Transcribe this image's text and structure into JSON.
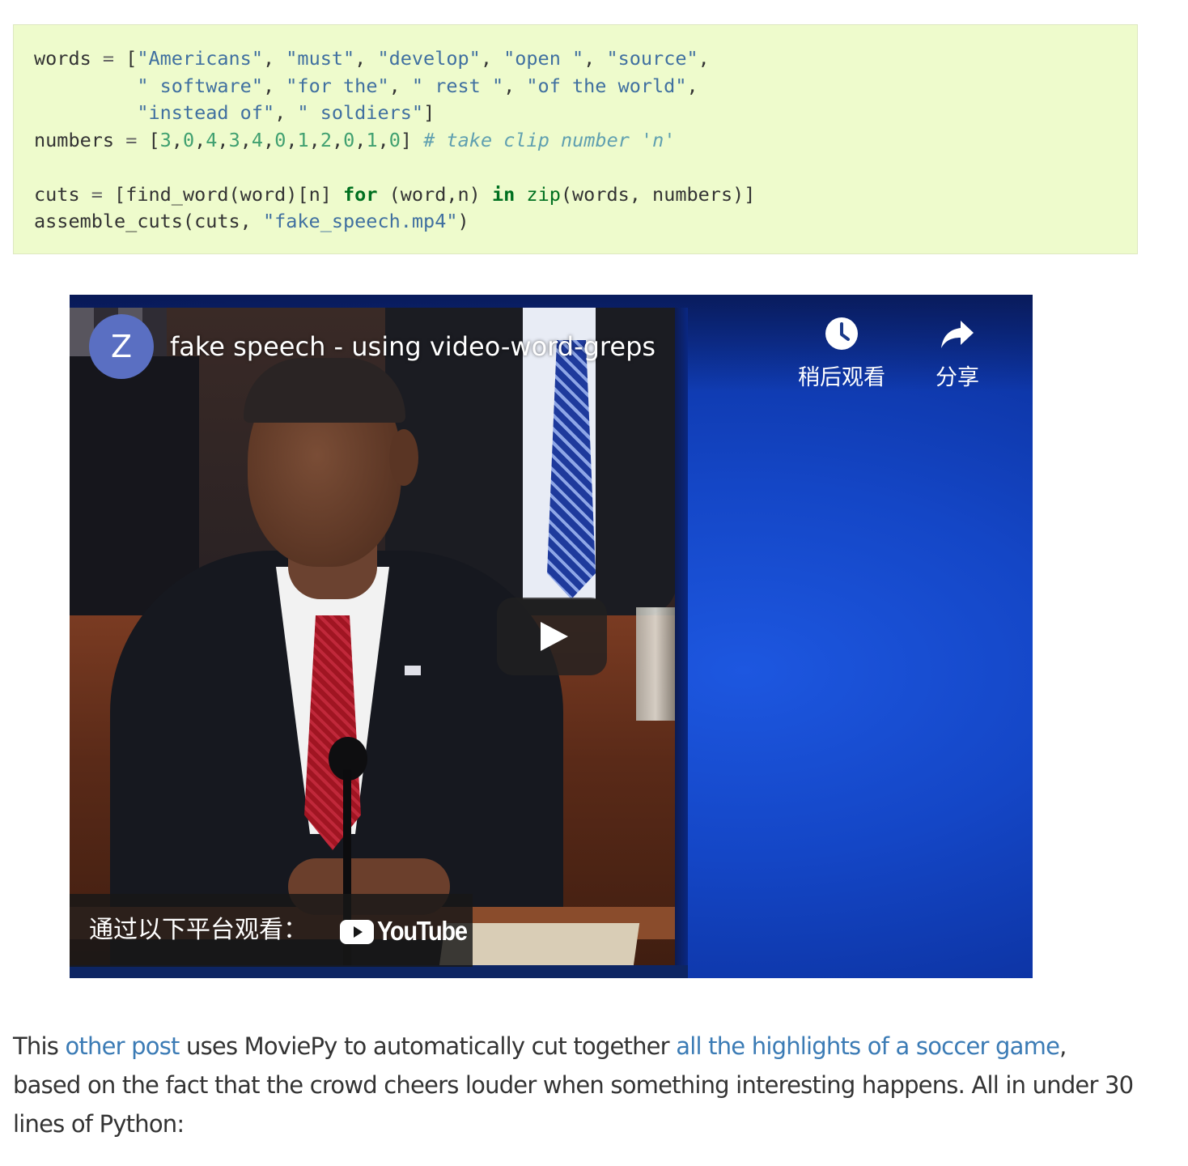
{
  "code_block": {
    "lines": [
      [
        {
          "t": "words ",
          "c": ""
        },
        {
          "t": "=",
          "c": "op"
        },
        {
          "t": " [",
          "c": ""
        },
        {
          "t": "\"Americans\"",
          "c": "str"
        },
        {
          "t": ", ",
          "c": ""
        },
        {
          "t": "\"must\"",
          "c": "str"
        },
        {
          "t": ", ",
          "c": ""
        },
        {
          "t": "\"develop\"",
          "c": "str"
        },
        {
          "t": ", ",
          "c": ""
        },
        {
          "t": "\"open \"",
          "c": "str"
        },
        {
          "t": ", ",
          "c": ""
        },
        {
          "t": "\"source\"",
          "c": "str"
        },
        {
          "t": ",",
          "c": ""
        }
      ],
      [
        {
          "t": "         ",
          "c": ""
        },
        {
          "t": "\" software\"",
          "c": "str"
        },
        {
          "t": ", ",
          "c": ""
        },
        {
          "t": "\"for the\"",
          "c": "str"
        },
        {
          "t": ", ",
          "c": ""
        },
        {
          "t": "\" rest \"",
          "c": "str"
        },
        {
          "t": ", ",
          "c": ""
        },
        {
          "t": "\"of the world\"",
          "c": "str"
        },
        {
          "t": ",",
          "c": ""
        }
      ],
      [
        {
          "t": "         ",
          "c": ""
        },
        {
          "t": "\"instead of\"",
          "c": "str"
        },
        {
          "t": ", ",
          "c": ""
        },
        {
          "t": "\" soldiers\"",
          "c": "str"
        },
        {
          "t": "]",
          "c": ""
        }
      ],
      [
        {
          "t": "numbers ",
          "c": ""
        },
        {
          "t": "=",
          "c": "op"
        },
        {
          "t": " [",
          "c": ""
        },
        {
          "t": "3",
          "c": "num"
        },
        {
          "t": ",",
          "c": ""
        },
        {
          "t": "0",
          "c": "num"
        },
        {
          "t": ",",
          "c": ""
        },
        {
          "t": "4",
          "c": "num"
        },
        {
          "t": ",",
          "c": ""
        },
        {
          "t": "3",
          "c": "num"
        },
        {
          "t": ",",
          "c": ""
        },
        {
          "t": "4",
          "c": "num"
        },
        {
          "t": ",",
          "c": ""
        },
        {
          "t": "0",
          "c": "num"
        },
        {
          "t": ",",
          "c": ""
        },
        {
          "t": "1",
          "c": "num"
        },
        {
          "t": ",",
          "c": ""
        },
        {
          "t": "2",
          "c": "num"
        },
        {
          "t": ",",
          "c": ""
        },
        {
          "t": "0",
          "c": "num"
        },
        {
          "t": ",",
          "c": ""
        },
        {
          "t": "1",
          "c": "num"
        },
        {
          "t": ",",
          "c": ""
        },
        {
          "t": "0",
          "c": "num"
        },
        {
          "t": "] ",
          "c": ""
        },
        {
          "t": "# take clip number 'n'",
          "c": "com"
        }
      ],
      [],
      [
        {
          "t": "cuts ",
          "c": ""
        },
        {
          "t": "=",
          "c": "op"
        },
        {
          "t": " [find_word(word)[n] ",
          "c": ""
        },
        {
          "t": "for",
          "c": "kw"
        },
        {
          "t": " (word,n) ",
          "c": ""
        },
        {
          "t": "in",
          "c": "kw"
        },
        {
          "t": " ",
          "c": ""
        },
        {
          "t": "zip",
          "c": "bi"
        },
        {
          "t": "(words, numbers)]",
          "c": ""
        }
      ],
      [
        {
          "t": "assemble_cuts(cuts, ",
          "c": ""
        },
        {
          "t": "\"fake_speech.mp4\"",
          "c": "str"
        },
        {
          "t": ")",
          "c": ""
        }
      ]
    ]
  },
  "video": {
    "channel_initial": "Z",
    "title": "fake speech - using video-word-greps",
    "watch_later_label": "稍后观看",
    "share_label": "分享",
    "watch_on_label": "通过以下平台观看：",
    "youtube_logo_text": "YouTube",
    "icons": {
      "watch_later": "clock-icon",
      "share": "share-arrow-icon",
      "play": "play-icon",
      "youtube": "youtube-logo-icon"
    },
    "colors": {
      "avatar": "#5a6fc2",
      "background_blue": "#1446c6",
      "youtube_red": "#ff0000"
    }
  },
  "paragraph": {
    "segments": [
      {
        "text": "This ",
        "link": false
      },
      {
        "text": "other post",
        "link": true
      },
      {
        "text": " uses MoviePy to automatically cut together ",
        "link": false
      },
      {
        "text": "all the highlights of a soccer game",
        "link": true
      },
      {
        "text": ", based on the fact that the crowd cheers louder when something interesting happens. All in under 30 lines of Python:",
        "link": false
      }
    ],
    "link_color": "#3b7bb5",
    "text_color": "#333333"
  }
}
